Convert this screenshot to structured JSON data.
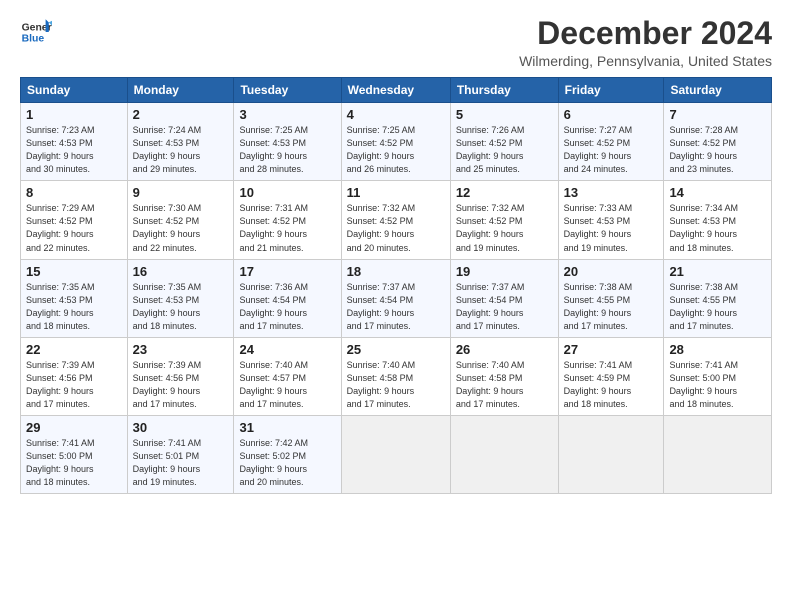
{
  "header": {
    "logo_line1": "General",
    "logo_line2": "Blue",
    "month": "December 2024",
    "location": "Wilmerding, Pennsylvania, United States"
  },
  "weekdays": [
    "Sunday",
    "Monday",
    "Tuesday",
    "Wednesday",
    "Thursday",
    "Friday",
    "Saturday"
  ],
  "weeks": [
    [
      {
        "day": "1",
        "info": "Sunrise: 7:23 AM\nSunset: 4:53 PM\nDaylight: 9 hours\nand 30 minutes."
      },
      {
        "day": "2",
        "info": "Sunrise: 7:24 AM\nSunset: 4:53 PM\nDaylight: 9 hours\nand 29 minutes."
      },
      {
        "day": "3",
        "info": "Sunrise: 7:25 AM\nSunset: 4:53 PM\nDaylight: 9 hours\nand 28 minutes."
      },
      {
        "day": "4",
        "info": "Sunrise: 7:25 AM\nSunset: 4:52 PM\nDaylight: 9 hours\nand 26 minutes."
      },
      {
        "day": "5",
        "info": "Sunrise: 7:26 AM\nSunset: 4:52 PM\nDaylight: 9 hours\nand 25 minutes."
      },
      {
        "day": "6",
        "info": "Sunrise: 7:27 AM\nSunset: 4:52 PM\nDaylight: 9 hours\nand 24 minutes."
      },
      {
        "day": "7",
        "info": "Sunrise: 7:28 AM\nSunset: 4:52 PM\nDaylight: 9 hours\nand 23 minutes."
      }
    ],
    [
      {
        "day": "8",
        "info": "Sunrise: 7:29 AM\nSunset: 4:52 PM\nDaylight: 9 hours\nand 22 minutes."
      },
      {
        "day": "9",
        "info": "Sunrise: 7:30 AM\nSunset: 4:52 PM\nDaylight: 9 hours\nand 22 minutes."
      },
      {
        "day": "10",
        "info": "Sunrise: 7:31 AM\nSunset: 4:52 PM\nDaylight: 9 hours\nand 21 minutes."
      },
      {
        "day": "11",
        "info": "Sunrise: 7:32 AM\nSunset: 4:52 PM\nDaylight: 9 hours\nand 20 minutes."
      },
      {
        "day": "12",
        "info": "Sunrise: 7:32 AM\nSunset: 4:52 PM\nDaylight: 9 hours\nand 19 minutes."
      },
      {
        "day": "13",
        "info": "Sunrise: 7:33 AM\nSunset: 4:53 PM\nDaylight: 9 hours\nand 19 minutes."
      },
      {
        "day": "14",
        "info": "Sunrise: 7:34 AM\nSunset: 4:53 PM\nDaylight: 9 hours\nand 18 minutes."
      }
    ],
    [
      {
        "day": "15",
        "info": "Sunrise: 7:35 AM\nSunset: 4:53 PM\nDaylight: 9 hours\nand 18 minutes."
      },
      {
        "day": "16",
        "info": "Sunrise: 7:35 AM\nSunset: 4:53 PM\nDaylight: 9 hours\nand 18 minutes."
      },
      {
        "day": "17",
        "info": "Sunrise: 7:36 AM\nSunset: 4:54 PM\nDaylight: 9 hours\nand 17 minutes."
      },
      {
        "day": "18",
        "info": "Sunrise: 7:37 AM\nSunset: 4:54 PM\nDaylight: 9 hours\nand 17 minutes."
      },
      {
        "day": "19",
        "info": "Sunrise: 7:37 AM\nSunset: 4:54 PM\nDaylight: 9 hours\nand 17 minutes."
      },
      {
        "day": "20",
        "info": "Sunrise: 7:38 AM\nSunset: 4:55 PM\nDaylight: 9 hours\nand 17 minutes."
      },
      {
        "day": "21",
        "info": "Sunrise: 7:38 AM\nSunset: 4:55 PM\nDaylight: 9 hours\nand 17 minutes."
      }
    ],
    [
      {
        "day": "22",
        "info": "Sunrise: 7:39 AM\nSunset: 4:56 PM\nDaylight: 9 hours\nand 17 minutes."
      },
      {
        "day": "23",
        "info": "Sunrise: 7:39 AM\nSunset: 4:56 PM\nDaylight: 9 hours\nand 17 minutes."
      },
      {
        "day": "24",
        "info": "Sunrise: 7:40 AM\nSunset: 4:57 PM\nDaylight: 9 hours\nand 17 minutes."
      },
      {
        "day": "25",
        "info": "Sunrise: 7:40 AM\nSunset: 4:58 PM\nDaylight: 9 hours\nand 17 minutes."
      },
      {
        "day": "26",
        "info": "Sunrise: 7:40 AM\nSunset: 4:58 PM\nDaylight: 9 hours\nand 17 minutes."
      },
      {
        "day": "27",
        "info": "Sunrise: 7:41 AM\nSunset: 4:59 PM\nDaylight: 9 hours\nand 18 minutes."
      },
      {
        "day": "28",
        "info": "Sunrise: 7:41 AM\nSunset: 5:00 PM\nDaylight: 9 hours\nand 18 minutes."
      }
    ],
    [
      {
        "day": "29",
        "info": "Sunrise: 7:41 AM\nSunset: 5:00 PM\nDaylight: 9 hours\nand 18 minutes."
      },
      {
        "day": "30",
        "info": "Sunrise: 7:41 AM\nSunset: 5:01 PM\nDaylight: 9 hours\nand 19 minutes."
      },
      {
        "day": "31",
        "info": "Sunrise: 7:42 AM\nSunset: 5:02 PM\nDaylight: 9 hours\nand 20 minutes."
      },
      null,
      null,
      null,
      null
    ]
  ]
}
